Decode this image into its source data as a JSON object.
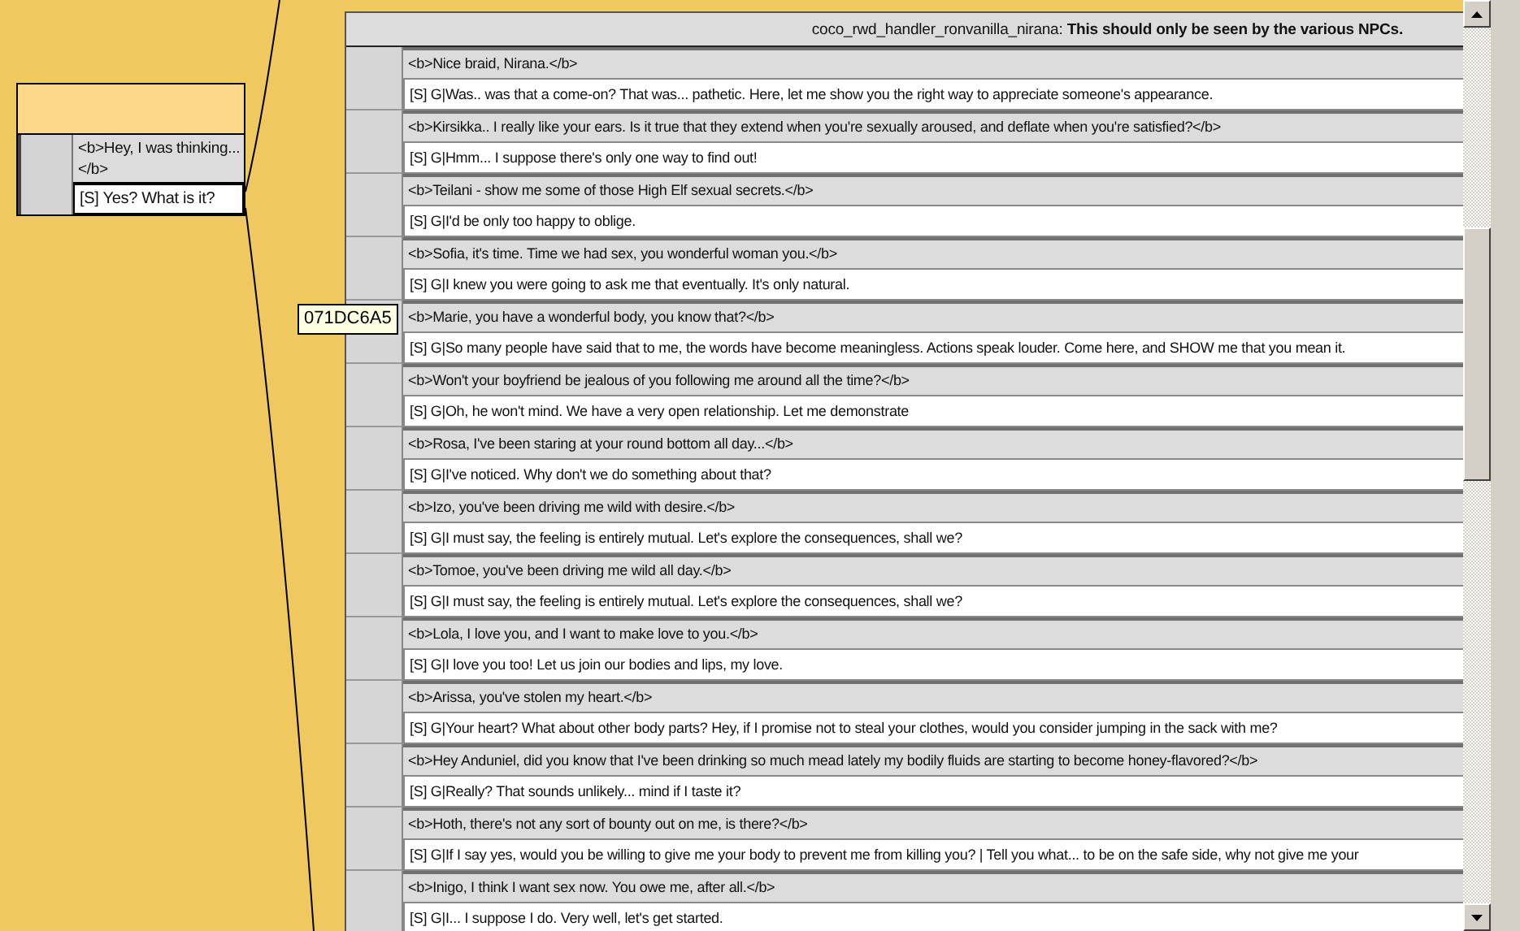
{
  "left_node": {
    "topics": [
      {
        "prompt": "<b>Hey, I was thinking...</b>",
        "response": "[S] Yes? What is it?"
      }
    ]
  },
  "tooltip": "071DC6A5",
  "panel": {
    "title": "coco_rwd_handler_ronvanilla_nirana:  **This should only be seen by the various NPCs.**",
    "topics": [
      {
        "prompt": "<b>Nice braid, Nirana.</b>",
        "response": "[S] G|Was.. was that a come-on? That was... pathetic. Here, let me show you the right way to appreciate someone's appearance."
      },
      {
        "prompt": "<b>Kirsikka.. I really like your ears. Is it true that they extend when you're sexually aroused, and deflate when you're satisfied?</b>",
        "response": "[S] G|Hmm... I suppose there's only one way to find out!"
      },
      {
        "prompt": "<b>Teilani - show me some of those High Elf sexual secrets.</b>",
        "response": "[S] G|I'd be only too happy to oblige."
      },
      {
        "prompt": "<b>Sofia, it's time. Time we had sex, you wonderful woman you.</b>",
        "response": "[S] G|I knew you were going to ask me that eventually. It's only natural."
      },
      {
        "prompt": "<b>Marie, you have a wonderful body, you know that?</b>",
        "response": "[S] G|So many people have said that to me, the words have become meaningless. Actions speak louder. Come here, and SHOW me that you mean it."
      },
      {
        "prompt": "<b>Won't your boyfriend be jealous of you following me around all the time?</b>",
        "response": "[S] G|Oh, he won't mind. We have a very open relationship. Let me demonstrate"
      },
      {
        "prompt": "<b>Rosa, I've been staring at your round bottom all day...</b>",
        "response": "[S] G|I've noticed. Why don't we do something about that?"
      },
      {
        "prompt": "<b>Izo, you've been driving me wild with desire.</b>",
        "response": "[S] G|I must say, the feeling is entirely mutual. Let's explore the consequences, shall we?"
      },
      {
        "prompt": "<b>Tomoe, you've been driving me wild all day.</b>",
        "response": "[S] G|I must say, the feeling is entirely mutual. Let's explore the consequences, shall we?"
      },
      {
        "prompt": "<b>Lola, I love you, and I want to make love to you.</b>",
        "response": "[S] G|I love you too! Let us join our bodies and lips, my love."
      },
      {
        "prompt": "<b>Arissa, you've stolen my heart.</b>",
        "response": "[S] G|Your heart? What about other body parts? Hey, if I promise not to steal your clothes, would you consider jumping in the sack with me?"
      },
      {
        "prompt": "<b>Hey Anduniel, did you know that I've been drinking so much mead lately my bodily fluids are starting to become honey-flavored?</b>",
        "response": "[S] G|Really? That sounds unlikely... mind if I taste it?"
      },
      {
        "prompt": "<b>Hoth, there's not any sort of bounty out on me, is there?</b>",
        "response": "[S] G|If I say yes, would you be willing to give me your body to prevent me from killing you? | Tell you what... to be on the safe side, why not give me your"
      },
      {
        "prompt": "<b>Inigo, I think I want sex now. You owe me, after all.</b>",
        "response": "[S] G|I... I suppose I do. Very well, let's get started."
      }
    ]
  }
}
